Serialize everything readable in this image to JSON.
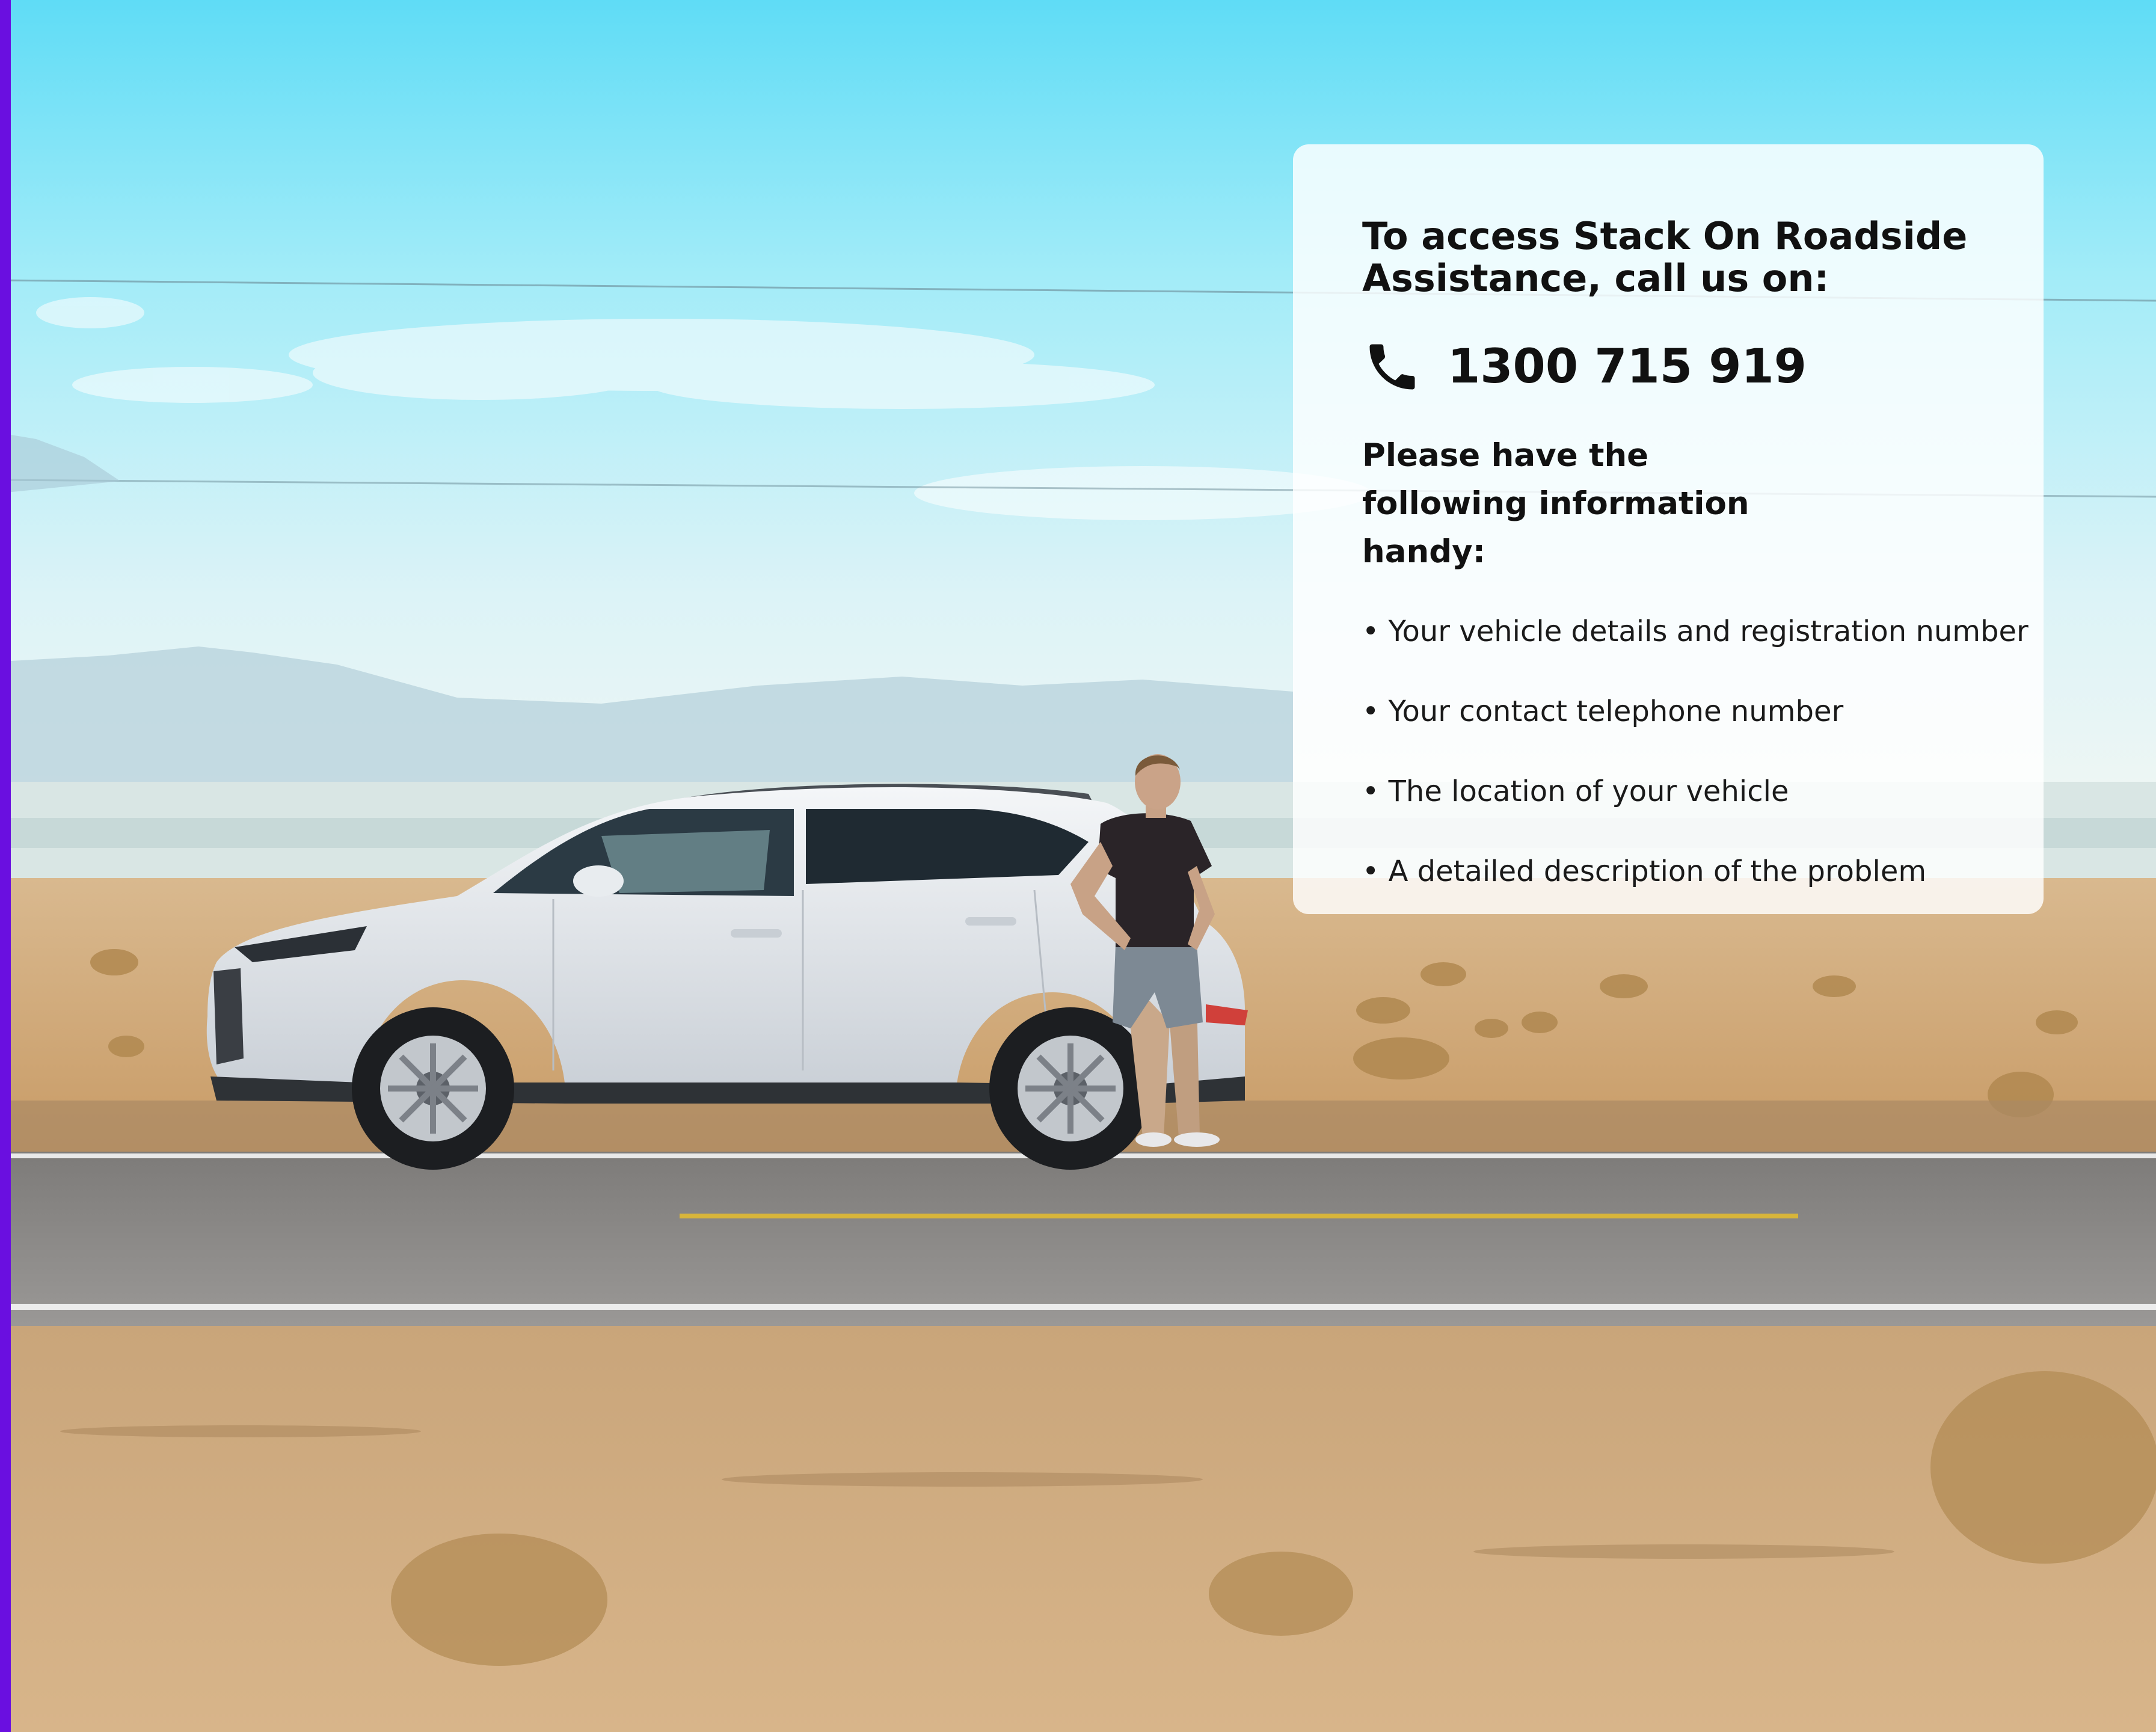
{
  "card": {
    "heading": "To access Stack On Roadside Assistance, call us on:",
    "phone_icon": "phone-icon",
    "phone_number": "1300 715 919",
    "info_heading": "Please have the following information handy:",
    "items": [
      "• Your vehicle details and registration number",
      "• Your contact telephone number",
      "• The location of your vehicle",
      "• A detailed description of the problem"
    ]
  },
  "colors": {
    "accent_bar": "#6a0fe0",
    "text": "#111111",
    "card_bg": "#ffffff"
  }
}
